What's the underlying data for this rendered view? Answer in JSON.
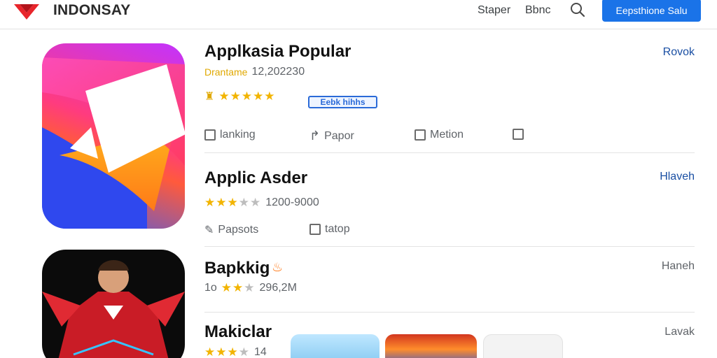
{
  "header": {
    "brand": "INDONSAY",
    "nav": [
      "Staper",
      "Bbnc"
    ],
    "cta_label": "Eepsthione Salu",
    "logo_icon": "red-diamond-logo-icon",
    "search_icon": "search-icon"
  },
  "apps": [
    {
      "title": "Applkasia Popular",
      "meta_prefix": "Drantame",
      "meta_value": "12,202230",
      "rating_stars": 5,
      "badge": "Eebk hihhs",
      "action": "Rovok",
      "features": [
        "lanking",
        "Papor",
        "Metion",
        ""
      ]
    },
    {
      "title": "Applic Asder",
      "rating_stars": 3.5,
      "meta_value": "1200-9000",
      "action": "Hlaveh",
      "features": [
        "Papsots",
        "tatop"
      ]
    },
    {
      "title": "Bapkkig",
      "meta_prefix": "1o",
      "rating_stars": 2,
      "meta_value": "296,2M",
      "action": "Haneh"
    },
    {
      "title": "Makiclar",
      "rating_stars": 3.5,
      "meta_value": "14",
      "action": "Lavak"
    }
  ],
  "colors": {
    "accent": "#1a73e8",
    "star": "#f2b400",
    "logo": "#e8252b"
  }
}
